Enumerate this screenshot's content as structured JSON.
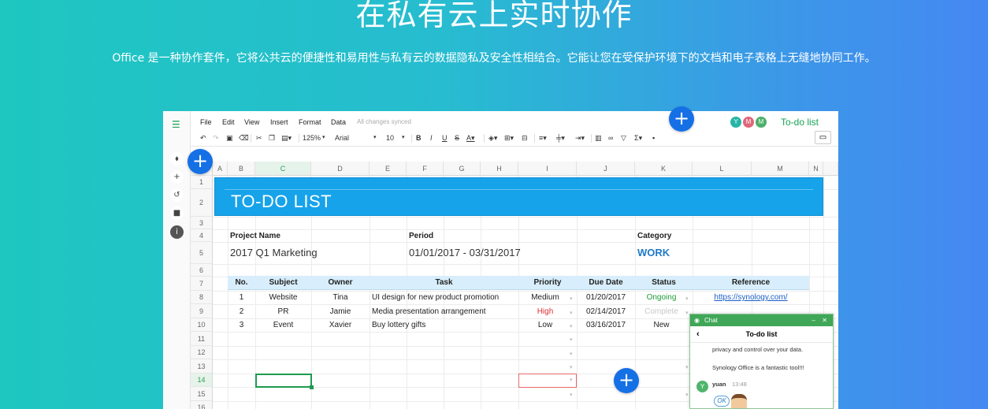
{
  "hero": {
    "title": "在私有云上实时协作",
    "subtitle": "Office 是一种协作套件，它将公共云的便捷性和易用性与私有云的数据隐私及安全性相结合。它能让您在受保护环境下的文档和电子表格上无缝地协同工作。"
  },
  "colors": {
    "accent_green": "#17a253",
    "banner_blue": "#16a3ea",
    "plus_blue": "#1570e6",
    "chat_green": "#3fa757"
  },
  "menu": {
    "items": [
      "File",
      "Edit",
      "View",
      "Insert",
      "Format",
      "Data"
    ],
    "status": "All changes synced"
  },
  "collaborators": [
    "Y",
    "M",
    "M"
  ],
  "document": {
    "title": "To-do list",
    "favorite_icon": "star-icon"
  },
  "toolbar": {
    "zoom": "125%",
    "font": "Arial",
    "font_size": "10"
  },
  "sheet": {
    "columns": [
      "A",
      "B",
      "C",
      "D",
      "E",
      "F",
      "G",
      "H",
      "I",
      "J",
      "K",
      "L",
      "M",
      "N"
    ],
    "rows": [
      "1",
      "2",
      "3",
      "4",
      "5",
      "6",
      "7",
      "8",
      "9",
      "10",
      "11",
      "12",
      "13",
      "14",
      "15",
      "16"
    ],
    "banner_title": "TO-DO LIST",
    "project_label": "Project Name",
    "project_value": "2017 Q1 Marketing",
    "period_label": "Period",
    "period_value": "01/01/2017 - 03/31/2017",
    "category_label": "Category",
    "category_value": "WORK",
    "table_headers": [
      "No.",
      "Subject",
      "Owner",
      "Task",
      "Priority",
      "Due Date",
      "Status",
      "Reference"
    ],
    "tasks": [
      {
        "no": "1",
        "subject": "Website",
        "owner": "Tina",
        "task": "UI design for new product promotion",
        "priority": "Medium",
        "due": "01/20/2017",
        "status": "Ongoing",
        "reference": "https://synology.com/"
      },
      {
        "no": "2",
        "subject": "PR",
        "owner": "Jamie",
        "task": "Media presentation arrangement",
        "priority": "High",
        "due": "02/14/2017",
        "status": "Complete",
        "reference": ""
      },
      {
        "no": "3",
        "subject": "Event",
        "owner": "Xavier",
        "task": "Buy lottery gifts",
        "priority": "Low",
        "due": "03/16/2017",
        "status": "New",
        "reference": ""
      }
    ]
  },
  "chat": {
    "header": "Chat",
    "title": "To-do list",
    "messages": [
      "privacy and control over your data.",
      "Synology Office is a fantastic tool!!!"
    ],
    "user": "yuan",
    "time": "13:48",
    "user_initial": "Y",
    "sticker_text": "OK"
  }
}
